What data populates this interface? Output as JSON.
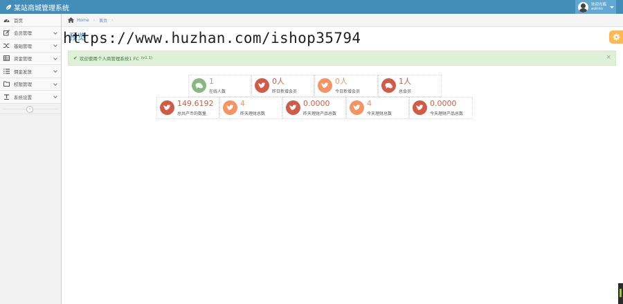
{
  "app": {
    "title": "某站商城管理系统"
  },
  "user": {
    "welcome": "欢迎光临",
    "name": "admin"
  },
  "sidebar": {
    "items": [
      {
        "label": "首页",
        "icon": "dashboard-icon",
        "has_children": false
      },
      {
        "label": "会员管理",
        "icon": "edit-icon",
        "has_children": true
      },
      {
        "label": "基础管理",
        "icon": "random-icon",
        "has_children": true
      },
      {
        "label": "资金管理",
        "icon": "table-icon",
        "has_children": true
      },
      {
        "label": "佣金发放",
        "icon": "list-icon",
        "has_children": true
      },
      {
        "label": "权限管理",
        "icon": "folder-icon",
        "has_children": true
      },
      {
        "label": "系统设置",
        "icon": "text-width-icon",
        "has_children": true
      }
    ],
    "collapse_icon": "double-angle-left-icon"
  },
  "breadcrumbs": {
    "home": "Home",
    "current": "首页"
  },
  "page_header": {
    "title": "预览"
  },
  "watermark": "https://www.huzhan.com/ishop35794",
  "alert": {
    "text": "欢迎使用个人商管理系统1 FC",
    "version": "(v1.1)",
    "close": "×"
  },
  "colors": {
    "navbar": "#438eb9",
    "green": "#87b87f",
    "red": "#d15b47",
    "orange": "#f79263",
    "accent": "#ffb752"
  },
  "stats_row1": [
    {
      "value": "1",
      "label": "在线人数",
      "color": "green",
      "icon": "comments-icon"
    },
    {
      "value": "0人",
      "label": "昨日新增会员",
      "color": "red",
      "icon": "twitter-icon"
    },
    {
      "value": "0人",
      "label": "今日新增会员",
      "color": "orange",
      "icon": "twitter-icon"
    },
    {
      "value": "1人",
      "label": "总会员",
      "color": "red",
      "icon": "comments-icon"
    }
  ],
  "stats_row2": [
    {
      "value": "149.6192",
      "label": "总共产币的数量",
      "color": "red",
      "icon": "twitter-icon"
    },
    {
      "value": "4",
      "label": "昨天理财总数",
      "color": "orange",
      "icon": "twitter-icon"
    },
    {
      "value": "0.0000",
      "label": "昨天理财产品总数",
      "color": "red",
      "icon": "twitter-icon"
    },
    {
      "value": "4",
      "label": "今天理财总数",
      "color": "orange",
      "icon": "twitter-icon"
    },
    {
      "value": "0.0000",
      "label": "今天理财产品总数",
      "color": "red",
      "icon": "twitter-icon"
    }
  ]
}
